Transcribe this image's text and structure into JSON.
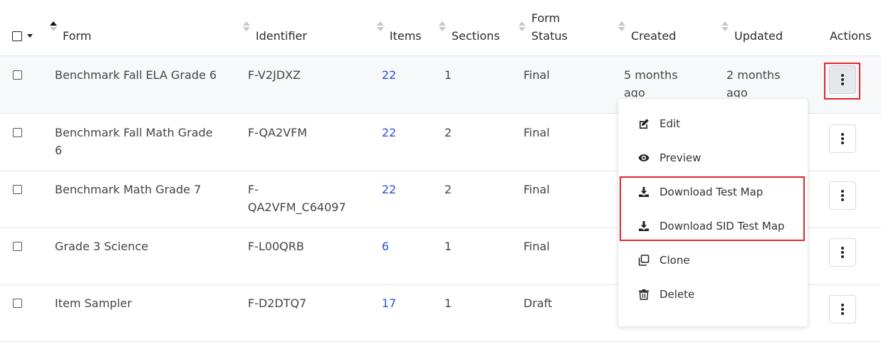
{
  "header": {
    "form": "Form",
    "identifier": "Identifier",
    "items": "Items",
    "sections": "Sections",
    "form_status": [
      "Form",
      "Status"
    ],
    "created": "Created",
    "updated": "Updated",
    "actions": "Actions"
  },
  "rows": [
    {
      "form": [
        "Benchmark Fall ELA Grade 6"
      ],
      "identifier": [
        "F-V2JDXZ"
      ],
      "items": "22",
      "sections": "1",
      "status": "Final",
      "created": [
        "5 months",
        "ago"
      ],
      "updated": [
        "2 months",
        "ago"
      ]
    },
    {
      "form": [
        "Benchmark Fall Math Grade",
        "6"
      ],
      "identifier": [
        "F-QA2VFM"
      ],
      "items": "22",
      "sections": "2",
      "status": "Final"
    },
    {
      "form": [
        "Benchmark Math Grade 7"
      ],
      "identifier": [
        "F-",
        "QA2VFM_C64097"
      ],
      "items": "22",
      "sections": "2",
      "status": "Final"
    },
    {
      "form": [
        "Grade 3 Science"
      ],
      "identifier": [
        "F-L00QRB"
      ],
      "items": "6",
      "sections": "1",
      "status": "Final"
    },
    {
      "form": [
        "Item Sampler"
      ],
      "identifier": [
        "F-D2DTQ7"
      ],
      "items": "17",
      "sections": "1",
      "status": "Draft"
    }
  ],
  "menu": {
    "edit": "Edit",
    "preview": "Preview",
    "download_test_map": "Download Test Map",
    "download_sid_test_map": "Download SID Test Map",
    "clone": "Clone",
    "delete": "Delete"
  },
  "colors": {
    "link": "#2d4fd6",
    "highlight_border": "#e0262b"
  },
  "icons": {
    "select_all": "checkbox-icon",
    "row_actions": "kebab-icon",
    "edit": "edit-icon",
    "preview": "eye-icon",
    "download": "download-icon",
    "clone": "copy-icon",
    "delete": "trash-icon"
  }
}
